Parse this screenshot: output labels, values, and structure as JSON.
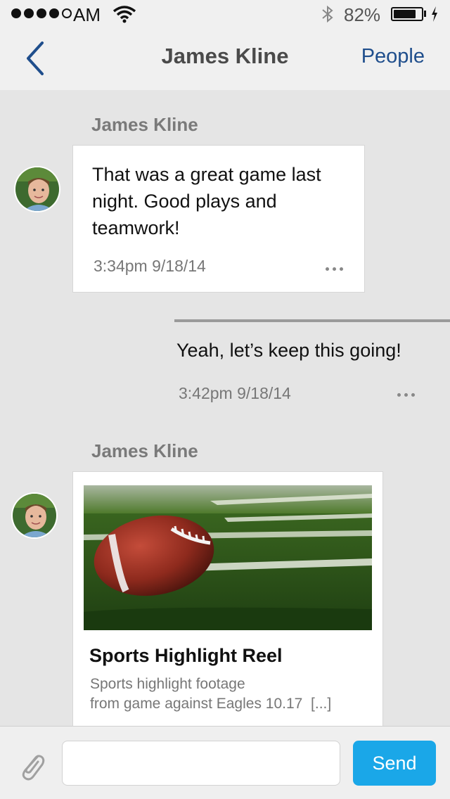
{
  "status_bar": {
    "carrier": "AM",
    "battery_percent": "82%",
    "battery_level": 0.82,
    "signal_bars_filled": 4,
    "signal_bars_total": 5
  },
  "nav": {
    "title": "James Kline",
    "right_label": "People",
    "back_icon": "chevron-left-icon",
    "accent_color": "#1f4e8c"
  },
  "messages": [
    {
      "sender": "James Kline",
      "text": "That was a great game last night. Good plays and teamwork!",
      "time": "3:34pm 9/18/14"
    },
    {
      "sender": "",
      "text": "Yeah, let’s keep this going!",
      "time": "3:42pm 9/18/14"
    },
    {
      "sender": "James Kline",
      "card": {
        "title": "Sports Highlight Reel",
        "description_line1": "Sports highlight footage",
        "description_line2": "from game against Eagles 10.17",
        "more": "[...]"
      }
    }
  ],
  "compose": {
    "placeholder": "",
    "send_label": "Send",
    "send_color": "#1aa7e8",
    "attach_icon": "paperclip-icon"
  }
}
